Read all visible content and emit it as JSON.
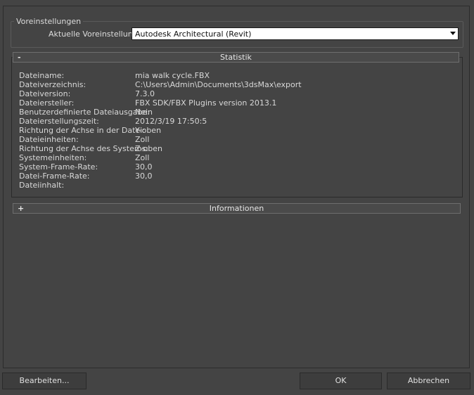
{
  "presets": {
    "group_title": "Voreinstellungen",
    "label": "Aktuelle Voreinstellung:",
    "selected": "Autodesk Architectural (Revit)"
  },
  "statistik": {
    "toggle": "-",
    "title": "Statistik",
    "rows": [
      {
        "key": "Dateiname:",
        "value": "mia walk cycle.FBX"
      },
      {
        "key": "Dateiverzeichnis:",
        "value": "C:\\Users\\Admin\\Documents\\3dsMax\\export"
      },
      {
        "key": "Dateiversion:",
        "value": "7.3.0"
      },
      {
        "key": "Dateiersteller:",
        "value": "FBX SDK/FBX Plugins version 2013.1"
      },
      {
        "key": "Benutzerdefinierte Dateiausgabe:",
        "value": "Nein"
      },
      {
        "key": "Dateierstellungszeit:",
        "value": "2012/3/19  17:50:5"
      },
      {
        "key": "Richtung der Achse in der Datei:",
        "value": "Y-oben"
      },
      {
        "key": "Dateieinheiten:",
        "value": "Zoll"
      },
      {
        "key": "Richtung der Achse des Systems:",
        "value": "Z-oben"
      },
      {
        "key": "Systemeinheiten:",
        "value": "Zoll"
      },
      {
        "key": "System-Frame-Rate:",
        "value": "30,0"
      },
      {
        "key": "Datei-Frame-Rate:",
        "value": "30,0"
      },
      {
        "key": "Dateiinhalt:",
        "value": ""
      }
    ]
  },
  "informationen": {
    "toggle": "+",
    "title": "Informationen"
  },
  "buttons": {
    "edit": "Bearbeiten...",
    "ok": "OK",
    "cancel": "Abbrechen"
  }
}
